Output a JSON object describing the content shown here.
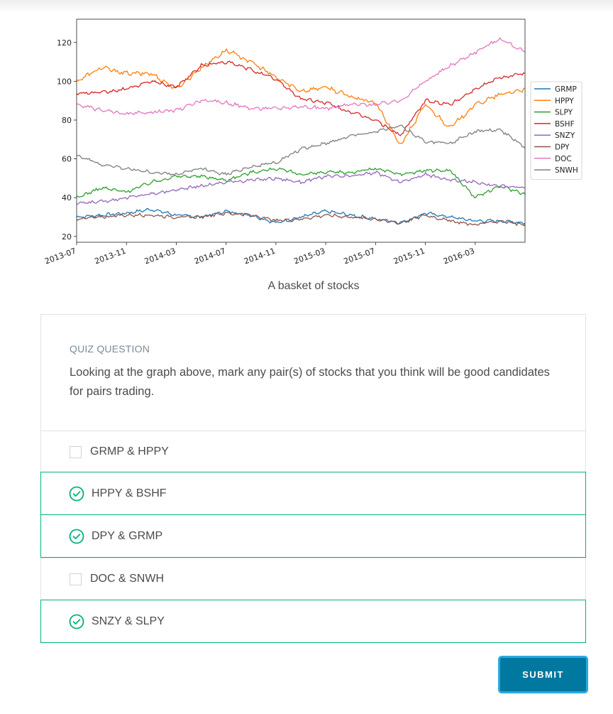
{
  "chart_data": {
    "type": "line",
    "title": "",
    "xlabel": "",
    "ylabel": "",
    "x_ticks": [
      "2013-07",
      "2013-11",
      "2014-03",
      "2014-07",
      "2014-11",
      "2015-03",
      "2015-07",
      "2015-11",
      "2016-03"
    ],
    "y_ticks": [
      20,
      40,
      60,
      80,
      100,
      120
    ],
    "x": [
      "2013-07",
      "2013-09",
      "2013-11",
      "2014-01",
      "2014-03",
      "2014-05",
      "2014-07",
      "2014-09",
      "2014-11",
      "2015-01",
      "2015-03",
      "2015-05",
      "2015-07",
      "2015-09",
      "2015-11",
      "2016-01",
      "2016-03",
      "2016-05",
      "2016-07"
    ],
    "ylim": [
      17,
      132
    ],
    "legend_position": "right",
    "series": [
      {
        "name": "GRMP",
        "color": "#1f77b4",
        "values": [
          30,
          31,
          32,
          34,
          31,
          30,
          33,
          31,
          27,
          30,
          33,
          31,
          29,
          27,
          32,
          30,
          28,
          28,
          27
        ]
      },
      {
        "name": "HPPY",
        "color": "#ff7f0e",
        "values": [
          100,
          107,
          104,
          104,
          96,
          107,
          116,
          110,
          102,
          95,
          97,
          92,
          89,
          67,
          88,
          76,
          88,
          93,
          96
        ]
      },
      {
        "name": "SLPY",
        "color": "#2ca02c",
        "values": [
          40,
          45,
          43,
          48,
          51,
          51,
          49,
          53,
          55,
          52,
          53,
          53,
          55,
          52,
          54,
          54,
          40,
          46,
          42
        ]
      },
      {
        "name": "BSHF",
        "color": "#d62728",
        "values": [
          94,
          94,
          96,
          100,
          97,
          108,
          110,
          106,
          101,
          91,
          89,
          84,
          80,
          72,
          90,
          88,
          96,
          102,
          104
        ]
      },
      {
        "name": "SNZY",
        "color": "#9467bd",
        "values": [
          37,
          38,
          40,
          42,
          44,
          46,
          48,
          49,
          50,
          48,
          51,
          51,
          53,
          48,
          52,
          49,
          48,
          46,
          45
        ]
      },
      {
        "name": "DPY",
        "color": "#8c564b",
        "values": [
          29,
          30,
          31,
          31,
          30,
          30,
          32,
          31,
          28,
          29,
          31,
          30,
          29,
          27,
          31,
          28,
          26,
          28,
          26
        ]
      },
      {
        "name": "DOC",
        "color": "#e377c2",
        "values": [
          88,
          85,
          83,
          84,
          85,
          90,
          89,
          86,
          86,
          87,
          86,
          88,
          88,
          90,
          100,
          108,
          115,
          122,
          115
        ]
      },
      {
        "name": "SNWH",
        "color": "#7f7f7f",
        "values": [
          62,
          57,
          55,
          53,
          52,
          55,
          52,
          56,
          58,
          65,
          68,
          72,
          74,
          77,
          69,
          68,
          74,
          75,
          66
        ]
      }
    ]
  },
  "caption": "A basket of stocks",
  "quiz": {
    "label": "QUIZ QUESTION",
    "question": "Looking at the graph above, mark any pair(s) of stocks that you think will be good candidates for pairs trading.",
    "options": [
      {
        "label": "GRMP & HPPY",
        "selected": false
      },
      {
        "label": "HPPY & BSHF",
        "selected": true
      },
      {
        "label": "DPY & GRMP",
        "selected": true
      },
      {
        "label": "DOC & SNWH",
        "selected": false
      },
      {
        "label": "SNZY & SLPY",
        "selected": true
      }
    ],
    "accent_color": "#02b37a"
  },
  "submit_label": "SUBMIT"
}
